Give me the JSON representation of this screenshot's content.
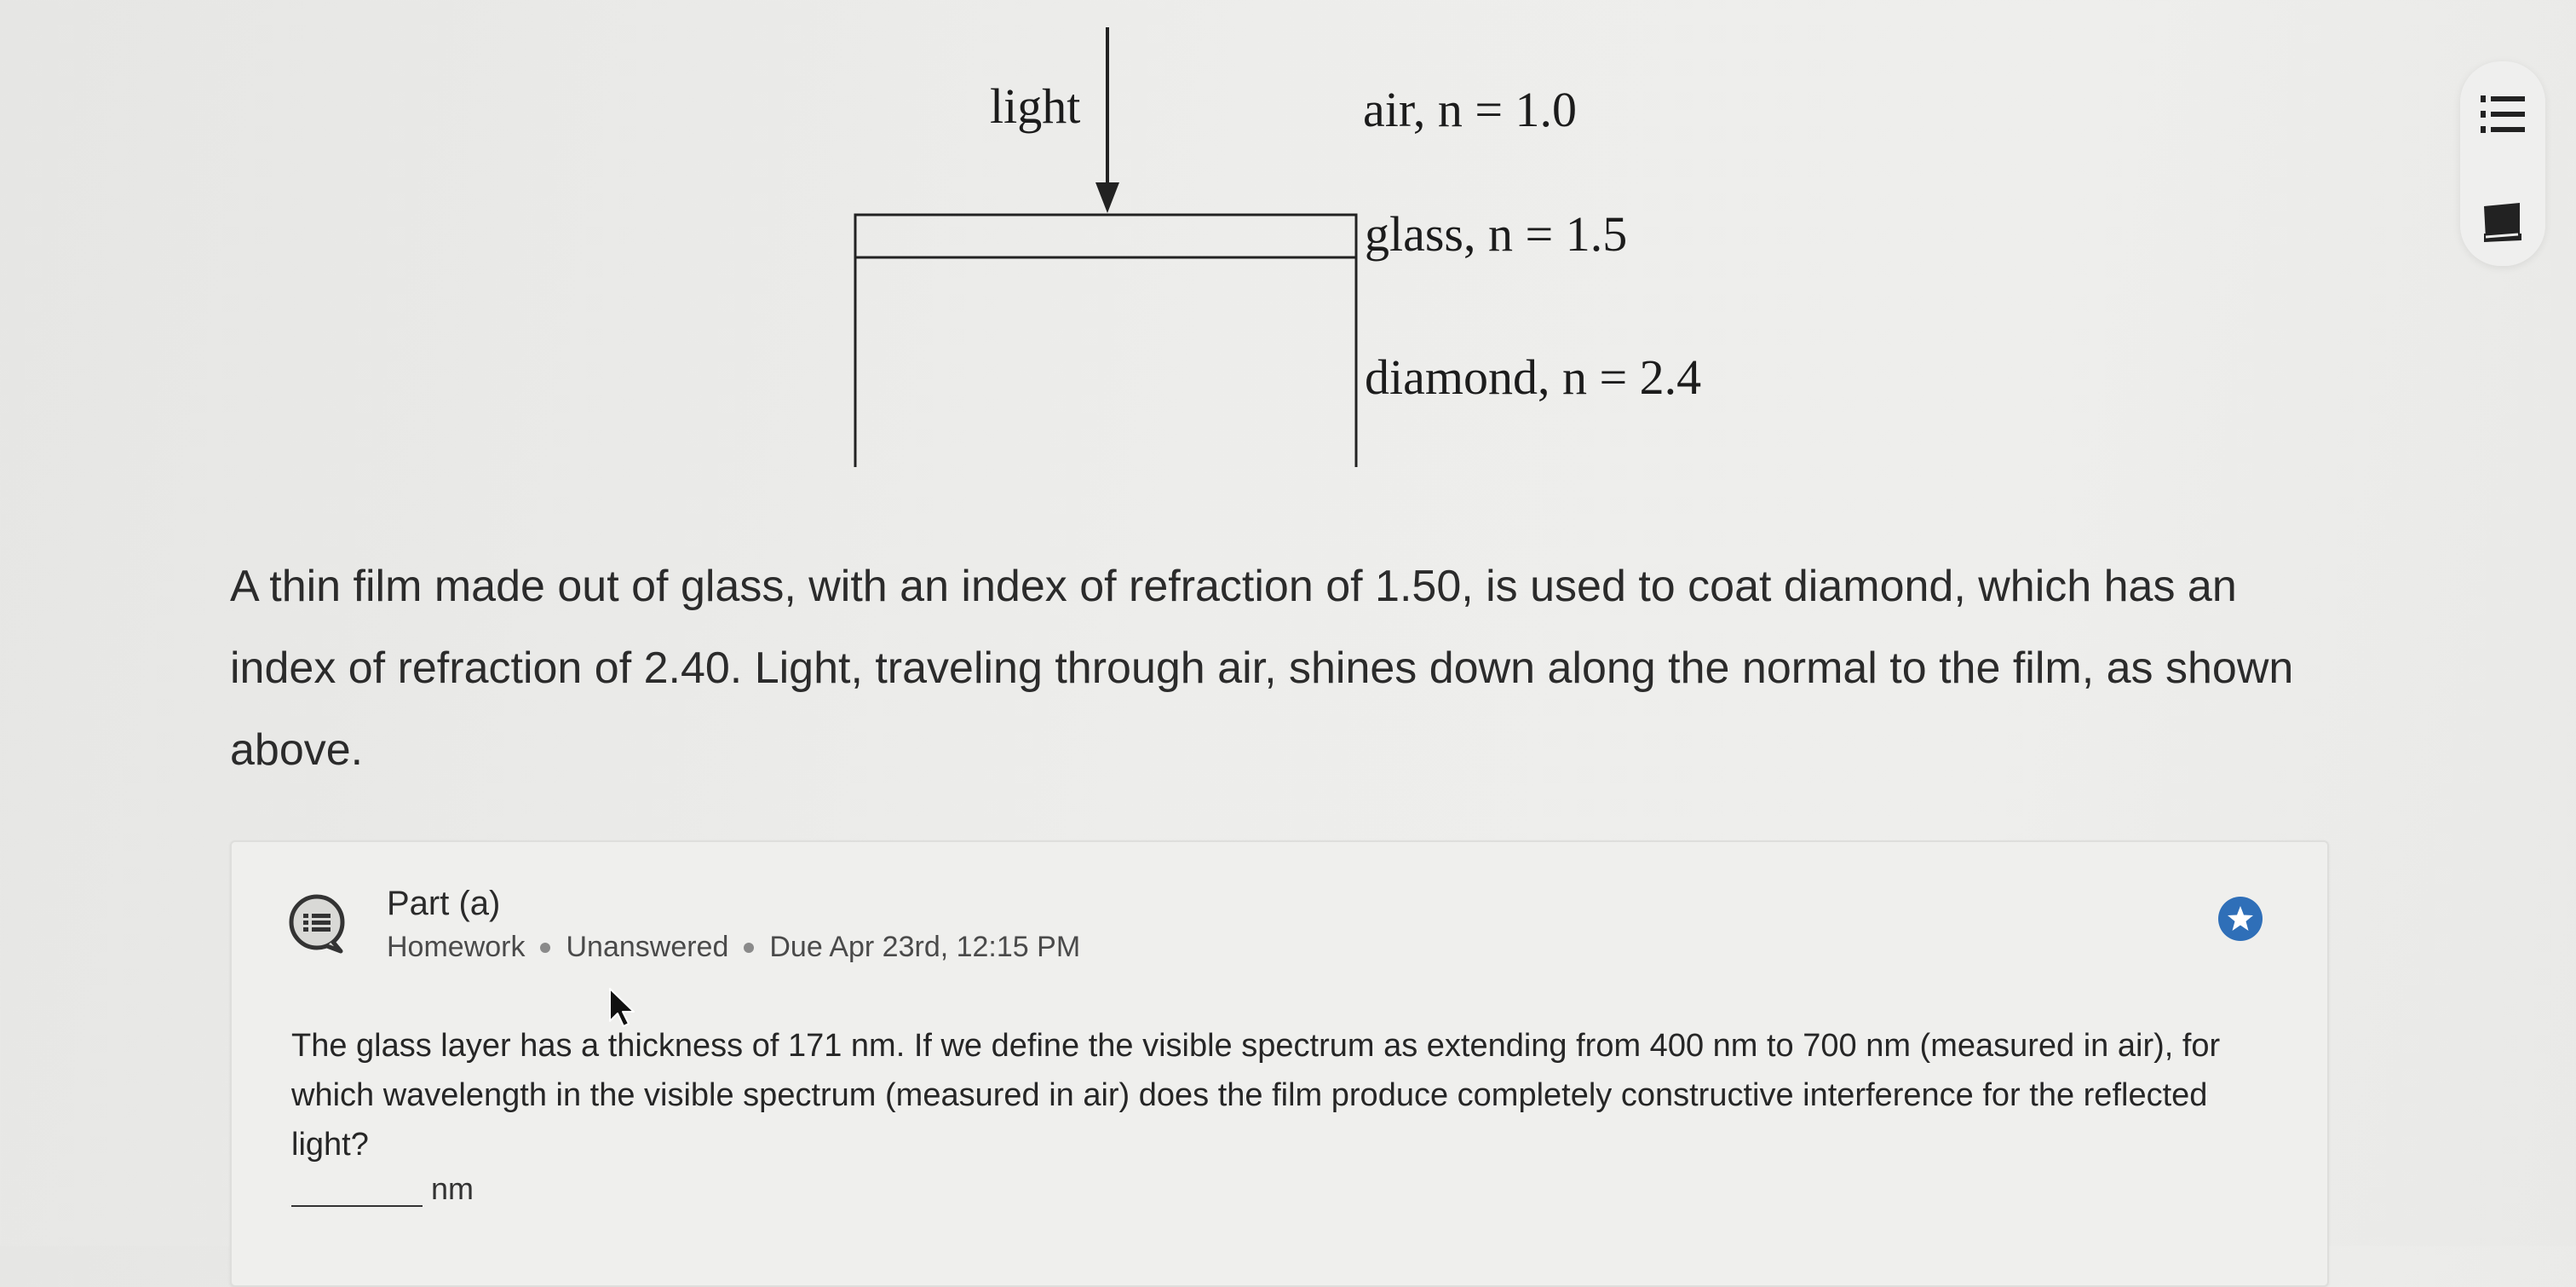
{
  "diagram": {
    "light_label": "light",
    "air_label": "air, n = 1.0",
    "glass_label": "glass, n = 1.5",
    "diamond_label": "diamond, n = 2.4"
  },
  "statement": {
    "text": "A thin film made out of glass, with an index of refraction of 1.50, is used to coat diamond, which has an index of refraction of 2.40.  Light, traveling through air, shines down along the normal to the film, as shown above."
  },
  "toolbar": {
    "icons": [
      "list-icon",
      "book-icon"
    ]
  },
  "part": {
    "title": "Part (a)",
    "type": "Homework",
    "status": "Unanswered",
    "due": "Due Apr 23rd, 12:15 PM",
    "question": "The glass layer has a thickness of 171 nm. If we define the visible spectrum as extending from 400 nm to 700 nm (measured in air), for which wavelength in the visible spectrum (measured in air) does the film produce completely constructive interference for the reflected light?",
    "answer_value": "",
    "unit": "nm"
  },
  "colors": {
    "accent_blue": "#2f6fb8",
    "text_dark": "#262626",
    "meta_gray": "#4a4a4a"
  }
}
